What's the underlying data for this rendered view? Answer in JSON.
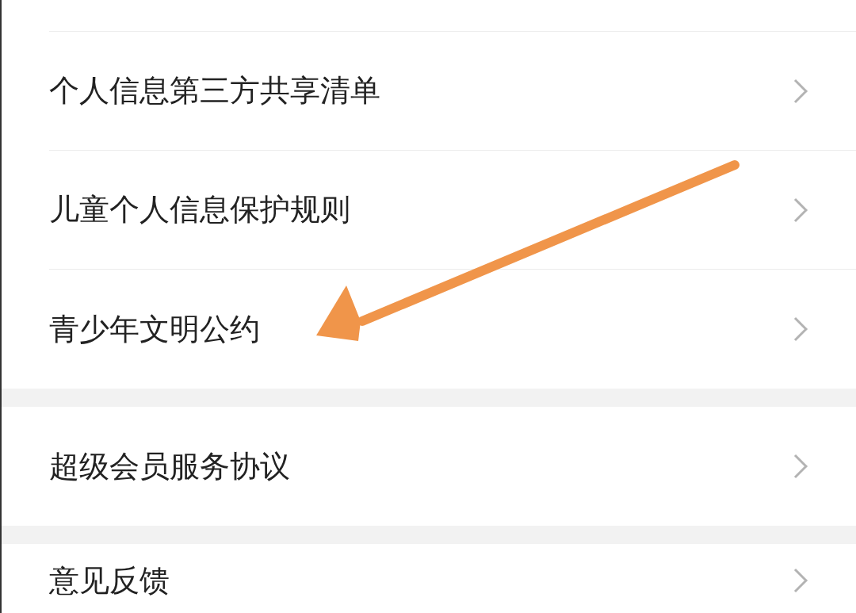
{
  "sections": [
    {
      "items": [
        {
          "label": "个人信息第三方共享清单"
        },
        {
          "label": "儿童个人信息保护规则"
        },
        {
          "label": "青少年文明公约"
        }
      ]
    },
    {
      "items": [
        {
          "label": "超级会员服务协议"
        }
      ]
    },
    {
      "items": [
        {
          "label": "意见反馈"
        }
      ]
    }
  ]
}
